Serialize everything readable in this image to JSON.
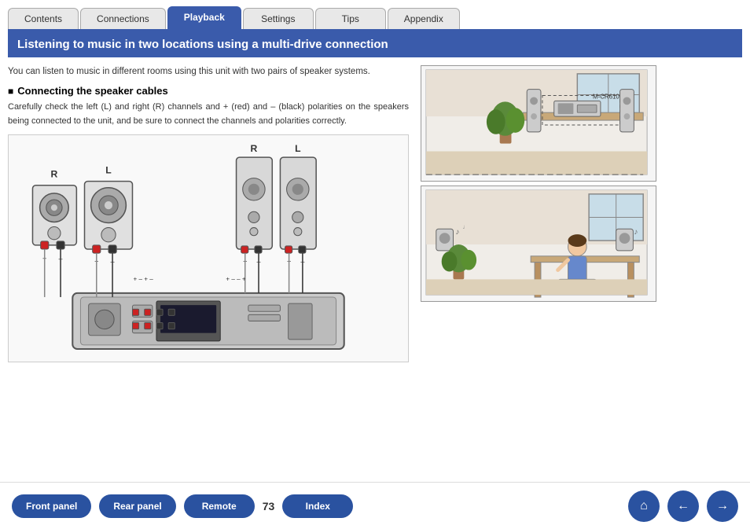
{
  "nav": {
    "tabs": [
      {
        "label": "Contents",
        "active": false
      },
      {
        "label": "Connections",
        "active": false
      },
      {
        "label": "Playback",
        "active": true
      },
      {
        "label": "Settings",
        "active": false
      },
      {
        "label": "Tips",
        "active": false
      },
      {
        "label": "Appendix",
        "active": false
      }
    ]
  },
  "page": {
    "title": "Listening to music in two locations using a multi-drive connection",
    "intro": "You can listen to music in different rooms using this unit with two pairs of speaker systems.",
    "section_title": "Connecting the speaker cables",
    "section_body": "Carefully check the left (L) and right (R) channels and + (red) and – (black) polarities on the speakers being connected to the unit, and be sure to connect the channels and polarities correctly.",
    "device_label": "M-CR610",
    "page_number": "73"
  },
  "footer": {
    "front_panel": "Front panel",
    "rear_panel": "Rear panel",
    "remote": "Remote",
    "index": "Index",
    "home_icon": "⌂",
    "back_icon": "←",
    "forward_icon": "→"
  }
}
